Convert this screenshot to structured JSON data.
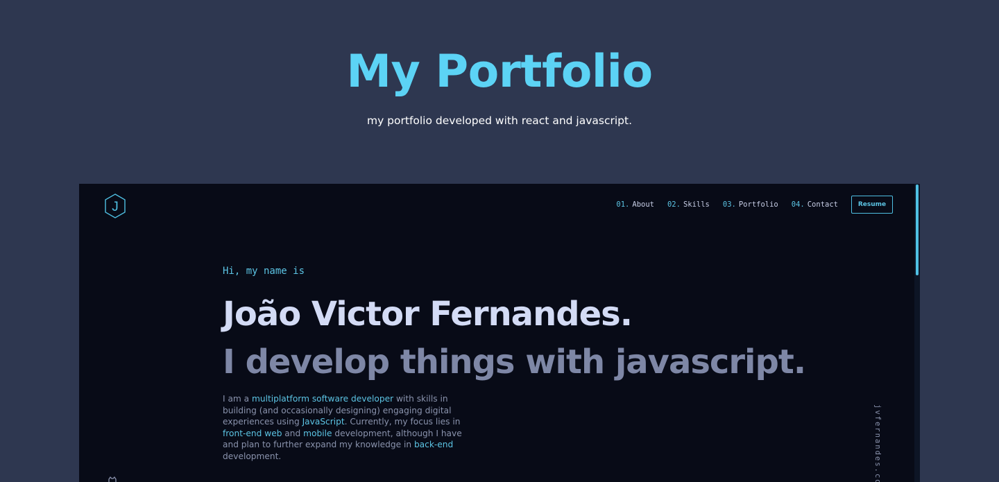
{
  "header": {
    "title": "My Portfolio",
    "subtitle": "my portfolio developed with react and javascript."
  },
  "site": {
    "logo_letter": "J",
    "nav": [
      {
        "num": "01.",
        "label": "About"
      },
      {
        "num": "02.",
        "label": "Skills"
      },
      {
        "num": "03.",
        "label": "Portfolio"
      },
      {
        "num": "04.",
        "label": "Contact"
      }
    ],
    "resume_label": "Resume",
    "hero": {
      "greeting": "Hi, my name is",
      "name": "João Victor Fernandes.",
      "tagline": "I develop things with javascript.",
      "bio": [
        {
          "text": "I am a ",
          "hl": false
        },
        {
          "text": "multiplatform software developer",
          "hl": true
        },
        {
          "text": " with skills in building (and occasionally designing) engaging digital experiences using ",
          "hl": false
        },
        {
          "text": "JavaScript",
          "hl": true
        },
        {
          "text": ". Currently, my focus lies in ",
          "hl": false
        },
        {
          "text": "front-end web",
          "hl": true
        },
        {
          "text": " and ",
          "hl": false
        },
        {
          "text": "mobile",
          "hl": true
        },
        {
          "text": " development, although I have and plan to further expand my knowledge in ",
          "hl": false
        },
        {
          "text": "back-end",
          "hl": true
        },
        {
          "text": " development.",
          "hl": false
        }
      ]
    },
    "side_email": "jvfernandes.cont",
    "icons": {
      "logo": "hexagon-j-logo-icon",
      "social": "github-icon"
    }
  },
  "colors": {
    "page_bg": "#2e3750",
    "accent": "#5cd3f5",
    "preview_bg": "#080b17",
    "name": "#d3dbf5",
    "tagline": "#7e87a6"
  }
}
